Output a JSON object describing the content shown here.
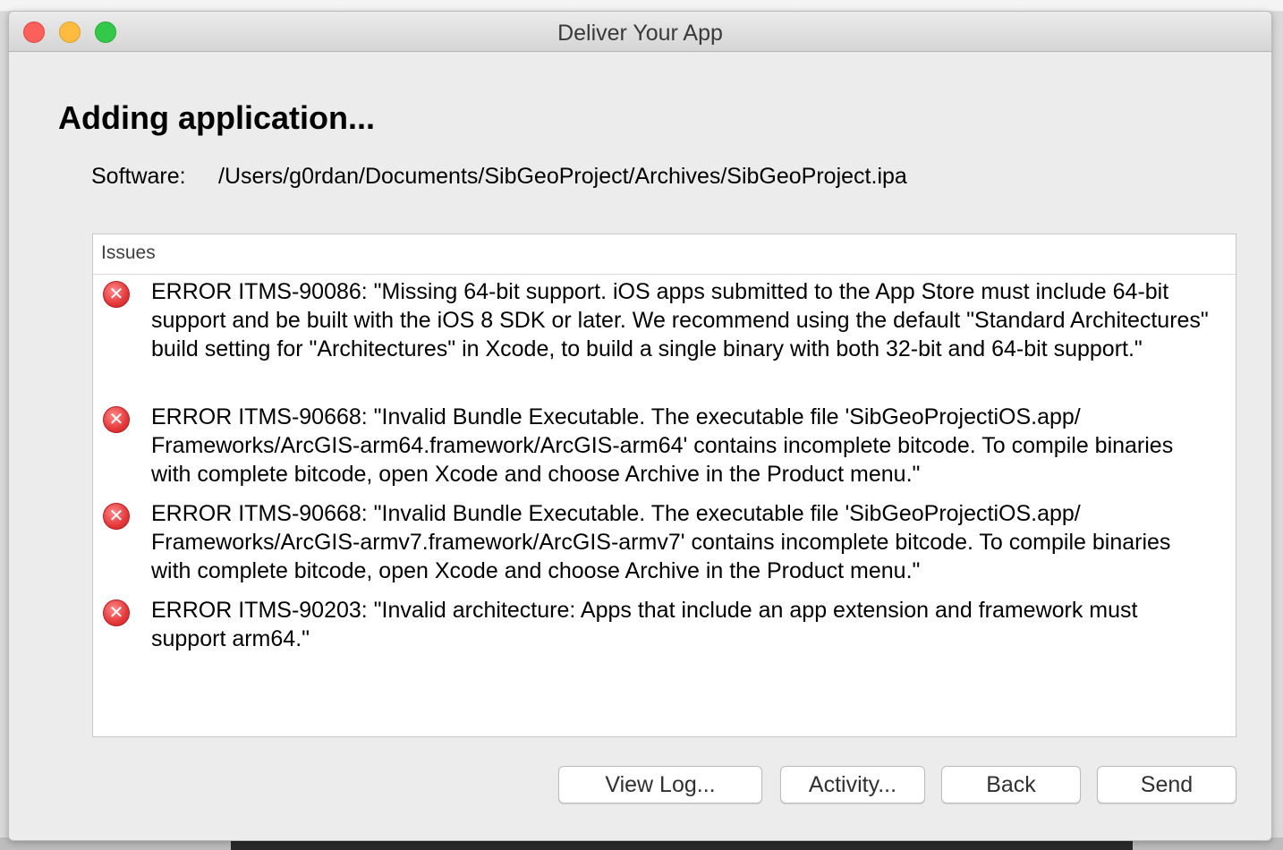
{
  "window": {
    "title": "Deliver Your App"
  },
  "main": {
    "heading": "Adding application...",
    "software_label": "Software:",
    "software_path": "/Users/g0rdan/Documents/SibGeoProject/Archives/SibGeoProject.ipa"
  },
  "issues": {
    "header": "Issues",
    "items": [
      {
        "icon": "error-icon",
        "text": "ERROR ITMS-90086: \"Missing 64-bit support. iOS apps submitted to the App Store must include 64-bit support and be built with the iOS 8 SDK or later. We recommend using the default \"Standard Architectures\" build setting for \"Architectures\" in Xcode, to build a single binary with both 32-bit and 64-bit support.\""
      },
      {
        "icon": "error-icon",
        "text": "ERROR ITMS-90668: \"Invalid Bundle Executable. The executable file 'SibGeoProjectiOS.app/ Frameworks/ArcGIS-arm64.framework/ArcGIS-arm64' contains incomplete bitcode. To compile binaries with complete bitcode, open Xcode and choose Archive in the Product menu.\""
      },
      {
        "icon": "error-icon",
        "text": "ERROR ITMS-90668: \"Invalid Bundle Executable. The executable file 'SibGeoProjectiOS.app/ Frameworks/ArcGIS-armv7.framework/ArcGIS-armv7' contains incomplete bitcode. To compile binaries with complete bitcode, open Xcode and choose Archive in the Product menu.\""
      },
      {
        "icon": "error-icon",
        "text": "ERROR ITMS-90203: \"Invalid architecture: Apps that include an app extension and framework must support arm64.\""
      }
    ]
  },
  "buttons": {
    "view_log": "View Log...",
    "activity": "Activity...",
    "back": "Back",
    "send": "Send"
  },
  "colors": {
    "close": "#fc605b",
    "minimize": "#fdbc40",
    "maximize": "#34c84a",
    "error": "#e4383a"
  }
}
